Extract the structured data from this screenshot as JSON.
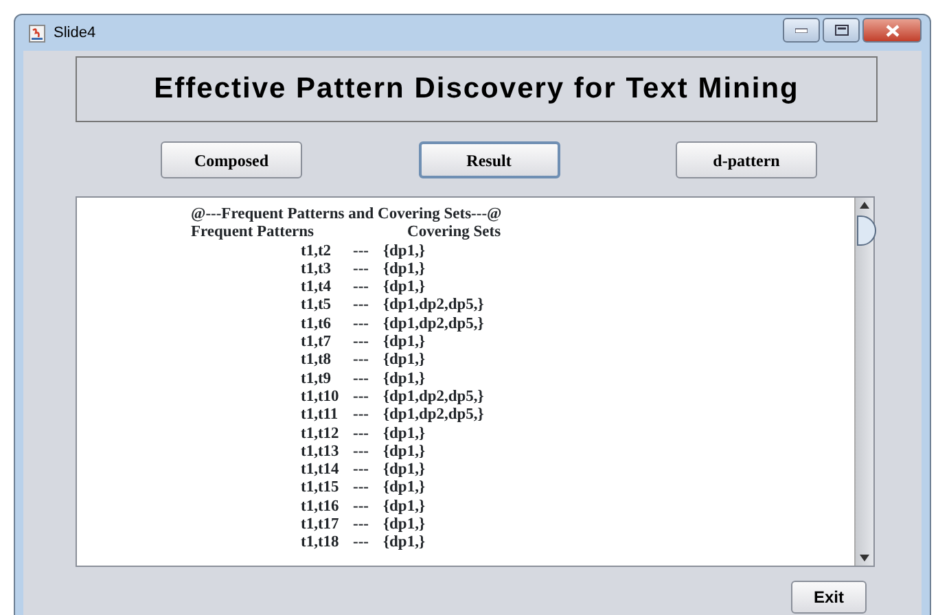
{
  "window": {
    "title": "Slide4"
  },
  "heading": "Effective Pattern Discovery for Text Mining",
  "buttons": [
    {
      "label": "Composed",
      "selected": false
    },
    {
      "label": "Result",
      "selected": true
    },
    {
      "label": "d-pattern",
      "selected": false
    }
  ],
  "output": {
    "title": "@---Frequent Patterns and Covering Sets---@",
    "column_1": "Frequent Patterns",
    "column_2": "Covering Sets",
    "rows": [
      {
        "pattern": "t1,t2",
        "separator": "---",
        "sets": "{dp1,}"
      },
      {
        "pattern": "t1,t3",
        "separator": "---",
        "sets": "{dp1,}"
      },
      {
        "pattern": "t1,t4",
        "separator": "---",
        "sets": "{dp1,}"
      },
      {
        "pattern": "t1,t5",
        "separator": "---",
        "sets": "{dp1,dp2,dp5,}"
      },
      {
        "pattern": "t1,t6",
        "separator": "---",
        "sets": "{dp1,dp2,dp5,}"
      },
      {
        "pattern": "t1,t7",
        "separator": "---",
        "sets": "{dp1,}"
      },
      {
        "pattern": "t1,t8",
        "separator": "---",
        "sets": "{dp1,}"
      },
      {
        "pattern": "t1,t9",
        "separator": "---",
        "sets": "{dp1,}"
      },
      {
        "pattern": "t1,t10",
        "separator": "---",
        "sets": "{dp1,dp2,dp5,}"
      },
      {
        "pattern": "t1,t11",
        "separator": "---",
        "sets": "{dp1,dp2,dp5,}"
      },
      {
        "pattern": "t1,t12",
        "separator": "---",
        "sets": "{dp1,}"
      },
      {
        "pattern": "t1,t13",
        "separator": "---",
        "sets": "{dp1,}"
      },
      {
        "pattern": "t1,t14",
        "separator": "---",
        "sets": "{dp1,}"
      },
      {
        "pattern": "t1,t15",
        "separator": "---",
        "sets": "{dp1,}"
      },
      {
        "pattern": "t1,t16",
        "separator": "---",
        "sets": "{dp1,}"
      },
      {
        "pattern": "t1,t17",
        "separator": "---",
        "sets": "{dp1,}"
      },
      {
        "pattern": "t1,t18",
        "separator": "---",
        "sets": "{dp1,}"
      }
    ]
  },
  "exit_button": "Exit"
}
